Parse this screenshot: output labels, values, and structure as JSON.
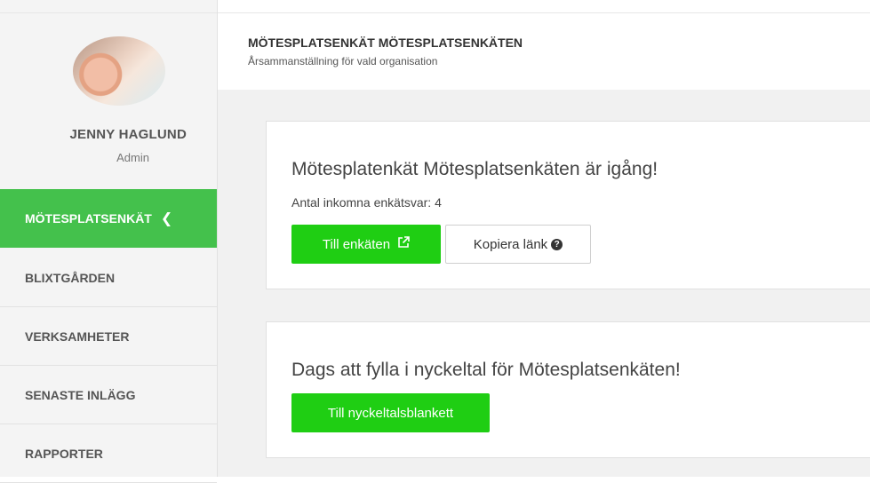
{
  "profile": {
    "name": "JENNY HAGLUND",
    "role": "Admin"
  },
  "sidebar": {
    "items": [
      {
        "label": "MÖTESPLATSENKÄT",
        "active": true,
        "icon": "chevron-left-icon"
      },
      {
        "label": "BLIXTGÅRDEN"
      },
      {
        "label": "VERKSAMHETER"
      },
      {
        "label": "SENASTE INLÄGG"
      },
      {
        "label": "RAPPORTER"
      }
    ]
  },
  "header": {
    "title": "MÖTESPLATSENKÄT MÖTESPLATSENKÄTEN",
    "subtitle": "Årsammanställning för vald organisation"
  },
  "survey_card": {
    "title": "Mötesplatenkät Mötesplatsenkäten är igång!",
    "responses_text": "Antal inkomna enkätsvar: 4",
    "open_button": "Till enkäten",
    "open_button_icon": "external-link-icon",
    "copy_button": "Kopiera länk",
    "copy_button_icon": "question-circle-icon"
  },
  "kpi_card": {
    "title": "Dags att fylla i nyckeltal för Mötesplatsenkäten!",
    "button": "Till nyckeltalsblankett"
  },
  "colors": {
    "accent": "#44c14c",
    "button_green": "#1fce13"
  }
}
